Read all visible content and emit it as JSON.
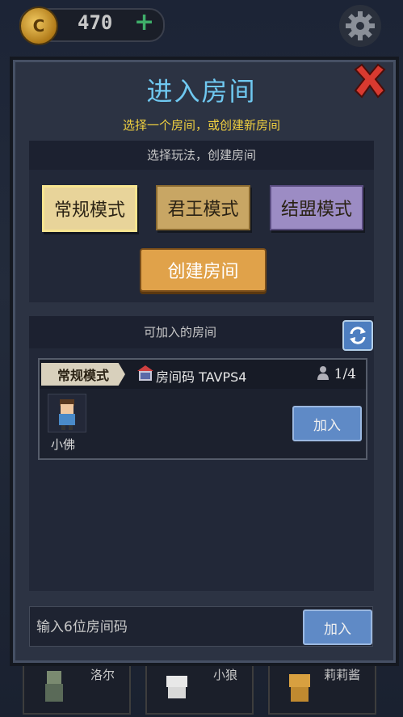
{
  "currency": {
    "amount": "470",
    "icon": "coin-icon",
    "add_icon": "plus-icon"
  },
  "settings": {
    "icon": "gear-icon"
  },
  "background_characters": [
    {
      "name": "洛尔"
    },
    {
      "name": "小狼"
    },
    {
      "name": "莉莉酱"
    }
  ],
  "dialog": {
    "title": "进入房间",
    "subtitle": "选择一个房间，或创建新房间",
    "close_icon": "close-x-icon",
    "create_panel": {
      "header": "选择玩法，创建房间",
      "modes": [
        {
          "label": "常规模式",
          "selected": true
        },
        {
          "label": "君王模式",
          "selected": false
        },
        {
          "label": "结盟模式",
          "selected": false
        }
      ],
      "create_button": "创建房间"
    },
    "rooms_panel": {
      "header": "可加入的房间",
      "refresh_icon": "refresh-icon",
      "rooms": [
        {
          "mode": "常规模式",
          "code_label": "房间码 TAVPS4",
          "count": "1/4",
          "player_name": "小佛",
          "join_button": "加入"
        }
      ]
    },
    "code_entry": {
      "placeholder": "输入6位房间码",
      "join_button": "加入"
    }
  },
  "colors": {
    "title": "#6fc8f0",
    "subtitle": "#f0d040",
    "join_button": "#5f8ac6",
    "create_button": "#e0a24a"
  }
}
